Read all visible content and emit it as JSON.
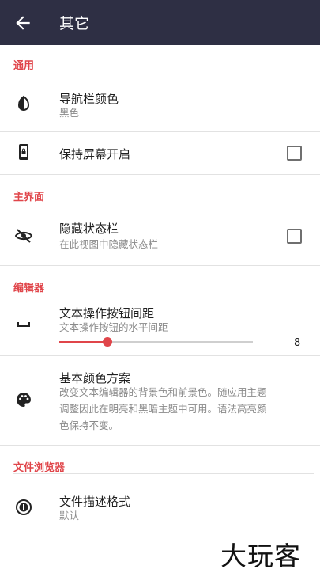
{
  "appbar": {
    "title": "其它"
  },
  "sections": {
    "general": "通用",
    "main_ui": "主界面",
    "editor": "编辑器",
    "file_browser": "文件浏览器"
  },
  "items": {
    "navbar_color": {
      "title": "导航栏颜色",
      "subtitle": "黑色"
    },
    "keep_screen_on": {
      "title": "保持屏幕开启",
      "checked": false
    },
    "hide_statusbar": {
      "title": "隐藏状态栏",
      "subtitle": "在此视图中隐藏状态栏",
      "checked": false
    },
    "button_spacing": {
      "title": "文本操作按钮间距",
      "subtitle": "文本操作按钮的水平间距",
      "value": "8",
      "slider_fraction": 0.25
    },
    "basic_color_scheme": {
      "title": "基本颜色方案",
      "subtitle_lines": [
        "改变文本编辑器的背景色和前景色。随应用主题",
        "调整因此在明亮和黑暗主题中可用。语法高亮颜",
        "色保持不变。"
      ]
    },
    "file_desc_format": {
      "title": "文件描述格式",
      "subtitle": "默认"
    }
  },
  "watermark": "大玩客",
  "colors": {
    "appbar": "#2e2f44",
    "accent": "#e0454a"
  }
}
